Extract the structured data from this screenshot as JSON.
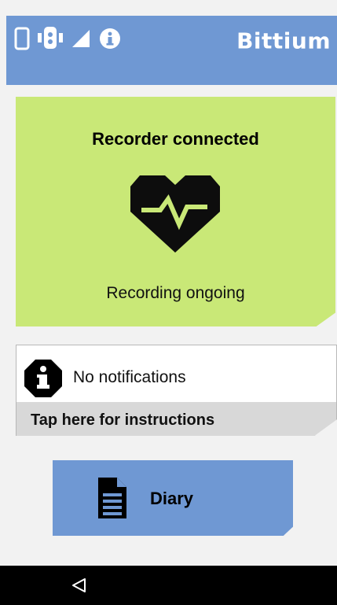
{
  "header": {
    "brand": "Bittium",
    "status_icons": [
      "phone-icon",
      "recorder-device-icon",
      "signal-icon",
      "info-icon"
    ]
  },
  "status_card": {
    "title": "Recorder connected",
    "icon": "heart-ecg-icon",
    "subtitle": "Recording ongoing",
    "color": "#c9e877"
  },
  "notifications": {
    "text": "No notifications",
    "link": "Tap here for instructions",
    "icon": "info-octagon-icon"
  },
  "diary": {
    "label": "Diary",
    "icon": "document-icon",
    "color": "#6f98d3"
  },
  "nav": {
    "back_icon": "back-triangle-icon"
  }
}
